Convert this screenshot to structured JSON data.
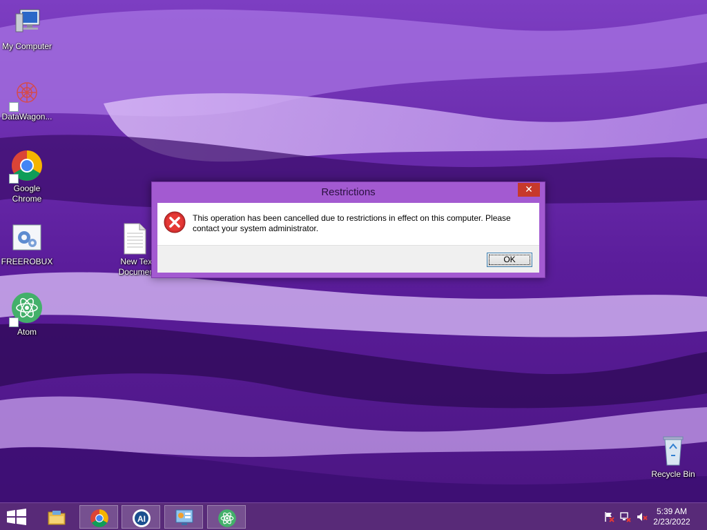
{
  "desktop": {
    "icons": [
      {
        "label": "My Computer"
      },
      {
        "label": "DataWagon..."
      },
      {
        "label": "Google Chrome"
      },
      {
        "label": "FREEROBUX"
      },
      {
        "label": "New Text Document"
      },
      {
        "label": "Atom"
      },
      {
        "label": "Recycle Bin"
      }
    ]
  },
  "dialog": {
    "title": "Restrictions",
    "close_label": "✕",
    "message": "This operation has been cancelled due to restrictions in effect on this computer. Please contact your system administrator.",
    "ok_label": "OK",
    "icon": "error-icon"
  },
  "taskbar": {
    "start": "windows-start-icon",
    "apps": [
      "file-explorer-icon",
      "chrome-icon",
      "ai-app-icon",
      "control-panel-icon",
      "atom-icon"
    ],
    "tray": [
      "action-center-flag-icon",
      "network-icon",
      "volume-muted-icon"
    ],
    "clock_time": "5:39 AM",
    "clock_date": "2/23/2022"
  },
  "colors": {
    "wallpaper": "#6b2aa8",
    "dialog_frame": "#a35ad1",
    "close_button": "#c7392b",
    "taskbar": "#5a2d78"
  }
}
